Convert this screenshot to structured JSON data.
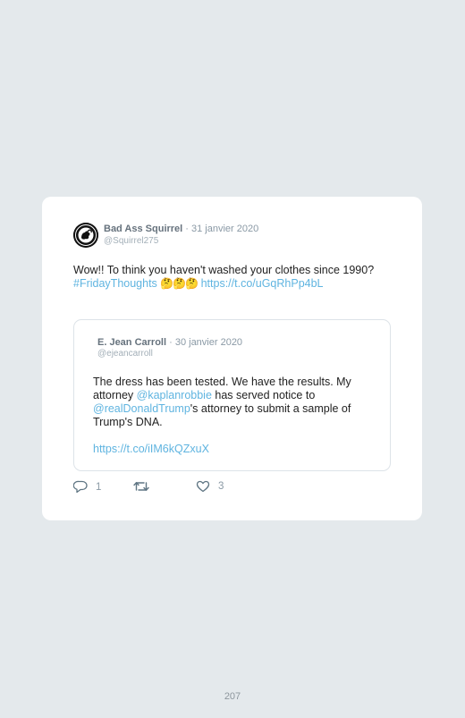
{
  "tweet": {
    "author_name": "Bad Ass Squirrel",
    "date": "· 31 janvier 2020",
    "handle": "@Squirrel275",
    "text_line": "Wow!! To think you haven't washed your clothes since 1990?",
    "hashtag": "#FridayThoughts",
    "emojis": "🤔🤔🤔",
    "link": "https://t.co/uGqRhPp4bL"
  },
  "quoted_tweet": {
    "author_name": "E. Jean Carroll",
    "date": "· 30 janvier 2020",
    "handle": "@ejeancarroll",
    "text_part1": "The dress has been tested. We have the results. My attorney ",
    "mention1": "@kaplanrobbie",
    "text_part2": " has served notice to ",
    "mention2": "@realDonaldTrump",
    "text_part3": "'s attorney to submit a sample of Trump's DNA.",
    "link": "https://t.co/iIM6kQZxuX"
  },
  "actions": {
    "reply_icon": "reply-icon",
    "reply_count": "1",
    "retweet_icon": "retweet-icon",
    "like_icon": "heart-icon",
    "like_count": "3"
  },
  "page_number": "207"
}
